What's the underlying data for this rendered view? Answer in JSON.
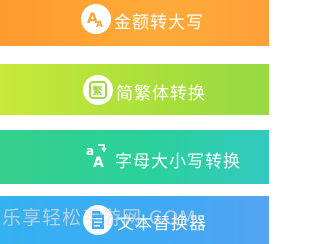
{
  "tiles": [
    {
      "label": "金额转大写",
      "icon": "amount-icon"
    },
    {
      "label": "简繁体转换",
      "icon": "traditional-icon"
    },
    {
      "label": "字母大小写转换",
      "icon": "letter-case-icon"
    },
    {
      "label": "文本替换器",
      "icon": "document-icon"
    }
  ],
  "watermark": {
    "text": "乐享轻松手游网.COM"
  },
  "colors": {
    "tile1": "#ffa236",
    "tile2": "#b4e23c",
    "tile3": "#2fcfa2",
    "tile4": "#3eacf3",
    "icon_text": "#ffffff"
  }
}
